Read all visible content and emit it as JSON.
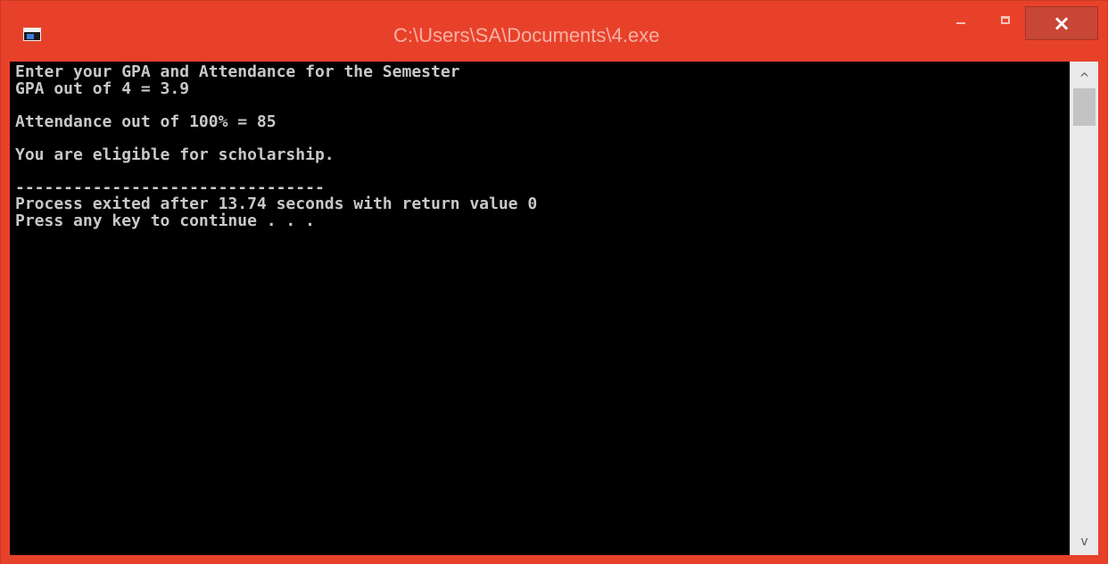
{
  "window": {
    "title": "C:\\Users\\SA\\Documents\\4.exe",
    "accent_color": "#e8412a",
    "controls": {
      "minimize_icon": "minimize-icon",
      "maximize_icon": "maximize-icon",
      "close_label": "×"
    }
  },
  "console": {
    "background": "#000000",
    "text_color": "#c8c8c8",
    "lines": [
      "Enter your GPA and Attendance for the Semester",
      "GPA out of 4 = 3.9",
      "",
      "Attendance out of 100% = 85",
      "",
      "You are eligible for scholarship.",
      "",
      "--------------------------------",
      "Process exited after 13.74 seconds with return value 0",
      "Press any key to continue . . ."
    ]
  },
  "scrollbar": {
    "up_arrow": "^",
    "down_arrow": "v"
  }
}
